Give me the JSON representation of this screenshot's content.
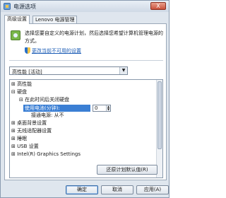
{
  "window": {
    "title": "电源选项",
    "close_label": "X"
  },
  "tabs": [
    {
      "label": "高级设置",
      "active": true
    },
    {
      "label": "Lenovo 电源管理",
      "active": false
    }
  ],
  "panel": {
    "description": "选择您要自定义的电源计划，然后选择您希望计算机管理电源的方式。",
    "change_link": "更改当前不可用的设置",
    "plan_select": {
      "value": "高性能 [活动]"
    }
  },
  "tree": {
    "items": [
      {
        "label": "高性能",
        "expander": "⊞"
      },
      {
        "label": "硬盘",
        "expander": "⊟"
      },
      {
        "label": "在此时间后关闭硬盘",
        "expander": "⊟"
      },
      {
        "label": "使用电池(分钟):",
        "value": "0"
      },
      {
        "label": "接通电源: 从不"
      },
      {
        "label": "桌面背景设置",
        "expander": "⊞"
      },
      {
        "label": "无线适配器设置",
        "expander": "⊞"
      },
      {
        "label": "睡眠",
        "expander": "⊞"
      },
      {
        "label": "USB 设置",
        "expander": "⊞"
      },
      {
        "label": "Intel(R) Graphics Settings",
        "expander": "⊞"
      }
    ]
  },
  "buttons": {
    "restore": "还原计划默认值(R)",
    "ok": "确定",
    "cancel": "取消",
    "apply": "应用(A)"
  },
  "colors": {
    "selection": "#3b7fd4",
    "link": "#1a5bb5",
    "window_bg": "#dfe6ee"
  }
}
